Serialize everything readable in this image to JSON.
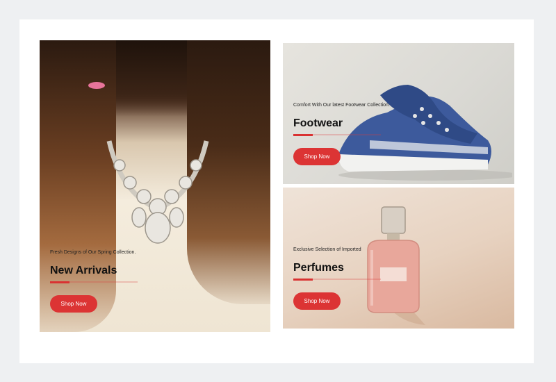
{
  "banners": [
    {
      "subtitle": "Fresh Designs of Our Spring Collection.",
      "title": "New Arrivals",
      "button": "Shop Now"
    },
    {
      "subtitle": "Comfort With Our latest Footwear Collection.",
      "title": "Footwear",
      "button": "Shop Now"
    },
    {
      "subtitle": "Exclusive Selection of Imported",
      "title": "Perfumes",
      "button": "Shop Now"
    }
  ],
  "colors": {
    "accent": "#dc3434",
    "page_background": "#eef0f2",
    "card_background": "#ffffff"
  }
}
